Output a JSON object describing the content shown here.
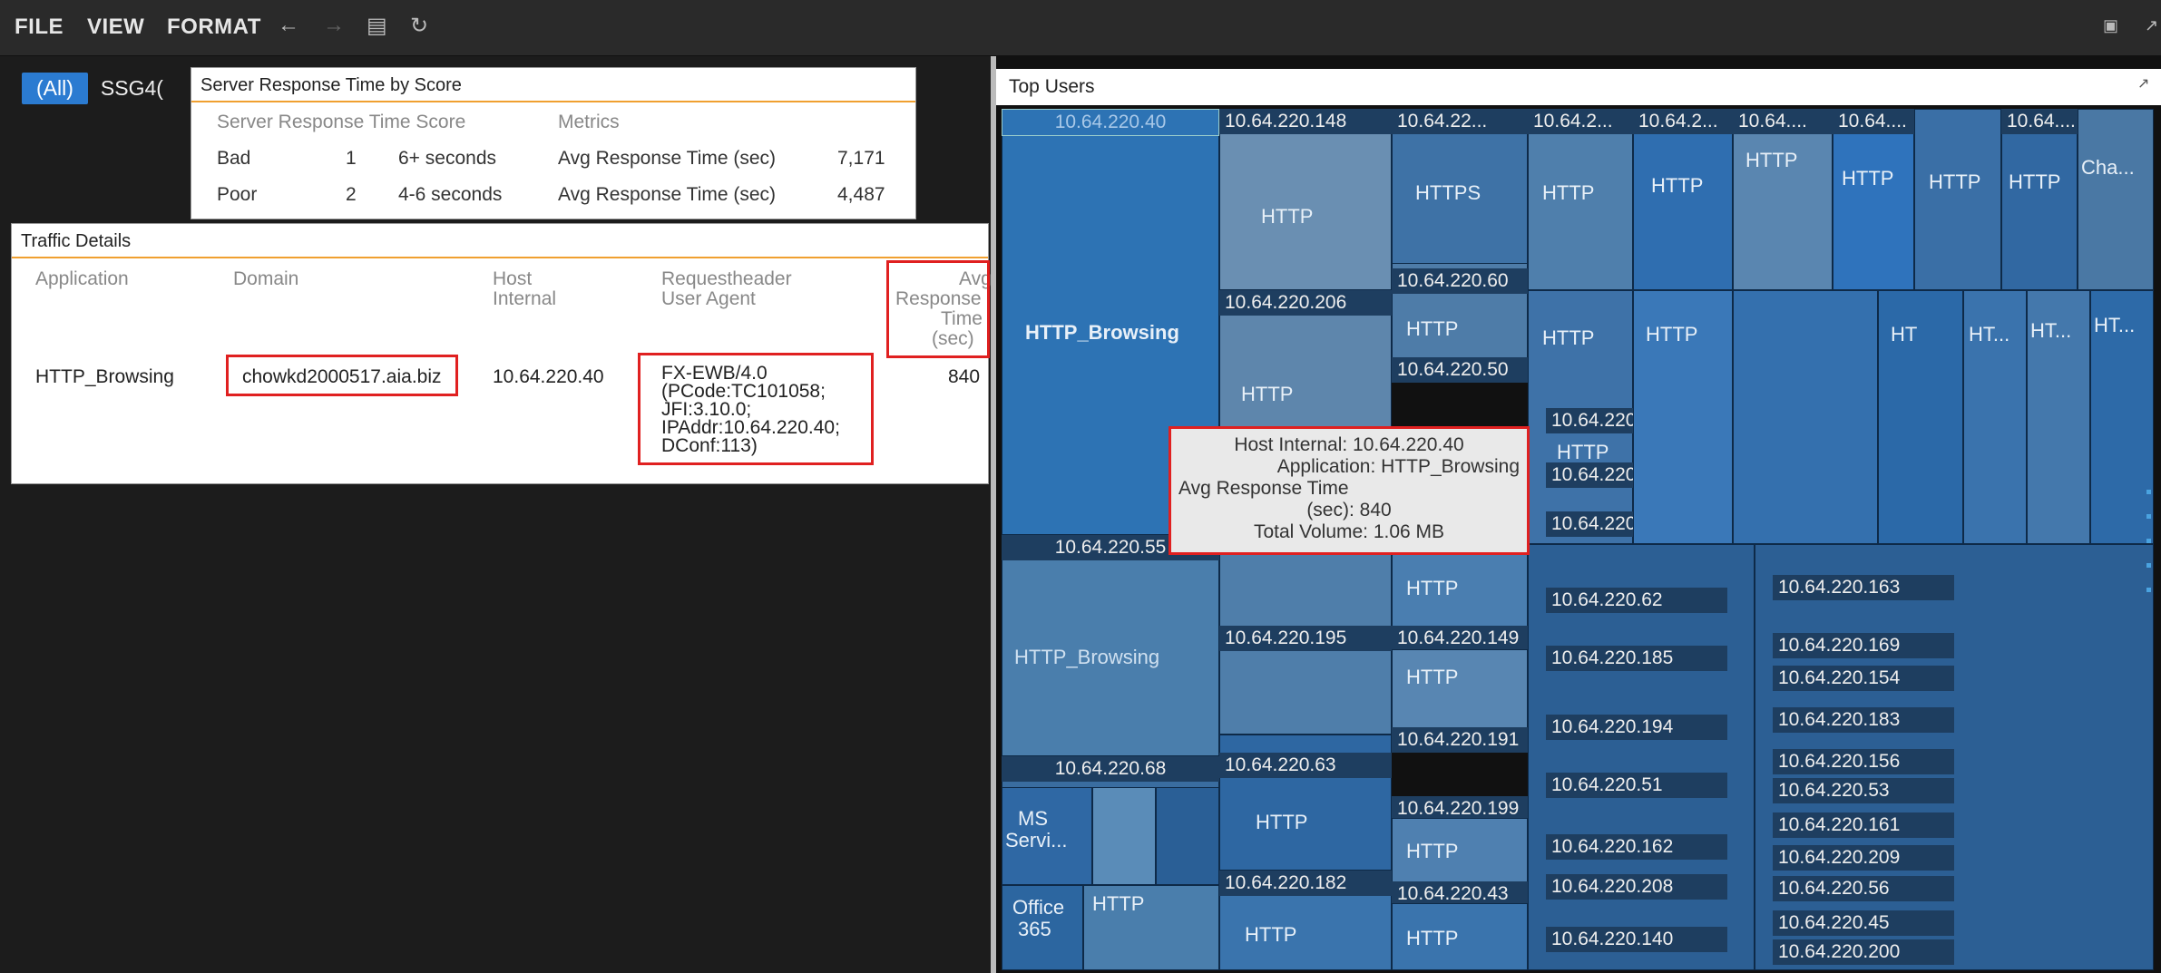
{
  "menu": {
    "file": "FILE",
    "view": "VIEW",
    "format": "FORMAT",
    "undo_icon": "undo-icon",
    "redo_icon": "redo-icon",
    "save_icon": "save-icon",
    "refresh_icon": "refresh-icon"
  },
  "filter": {
    "all": "(All)",
    "ssg": "SSG4("
  },
  "srt": {
    "title": "Server Response Time by Score",
    "headers": [
      "Server Response Time Score",
      "Metrics"
    ],
    "rows": [
      {
        "label": "Bad",
        "score": "1",
        "range": "6+ seconds",
        "metric": "Avg Response Time (sec)",
        "value": "7,171"
      },
      {
        "label": "Poor",
        "score": "2",
        "range": "4-6 seconds",
        "metric": "Avg Response Time (sec)",
        "value": "4,487"
      }
    ]
  },
  "traffic": {
    "title": "Traffic Details",
    "headers": {
      "application": "Application",
      "domain": "Domain",
      "host1": "Host",
      "host2": "Internal",
      "req1": "Requestheader",
      "req2": "User Agent",
      "avg1": "Avg",
      "avg2": "Response",
      "avg3": "Time",
      "avg4": "(sec)"
    },
    "row": {
      "application": "HTTP_Browsing",
      "domain": "chowkd2000517.aia.biz",
      "host": "10.64.220.40",
      "ua1": "FX-EWB/4.0",
      "ua2": "(PCode:TC101058;",
      "ua3": "JFI:3.10.0;",
      "ua4": "IPAddr:10.64.220.40;",
      "ua5": "DConf:113)",
      "avg": "840"
    }
  },
  "topusers": {
    "title": "Top Users",
    "labels": {
      "h40": "10.64.220.40",
      "h148": "10.64.220.148",
      "h22": "10.64.22...",
      "h2a": "10.64.2...",
      "h2b": "10.64.2...",
      "h64a": "10.64....",
      "h64b": "10.64....",
      "h64c": "10.64....",
      "h206": "10.64.220.206",
      "h60": "10.64.220.60",
      "h50": "10.64.220.50",
      "h168": "10.64.220.168",
      "h167": "10.64.220.167",
      "h55": "10.64.220.55",
      "h90": "10.64.220.90",
      "h62": "10.64.220.62",
      "h163": "10.64.220.163",
      "h195": "10.64.220.195",
      "h149": "10.64.220.149",
      "h169": "10.64.220.169",
      "h185": "10.64.220.185",
      "h154": "10.64.220.154",
      "h191": "10.64.220.191",
      "h194": "10.64.220.194",
      "h183": "10.64.220.183",
      "h156": "10.64.220.156",
      "h68": "10.64.220.68",
      "h63": "10.64.220.63",
      "h51": "10.64.220.51",
      "h53": "10.64.220.53",
      "h199": "10.64.220.199",
      "h162": "10.64.220.162",
      "h161": "10.64.220.161",
      "h209": "10.64.220.209",
      "h182": "10.64.220.182",
      "h208": "10.64.220.208",
      "h43": "10.64.220.43",
      "h56": "10.64.220.56",
      "h45": "10.64.220.45",
      "h140": "10.64.220.140",
      "h200": "10.64.220.200"
    },
    "apps": {
      "http": "HTTP",
      "https": "HTTPS",
      "browsing": "HTTP_Browsing",
      "cha": "Cha...",
      "ht": "HT...",
      "ht2": "HT",
      "ms1": "MS",
      "ms2": "Servi...",
      "office1": "Office",
      "office2": "365"
    }
  },
  "tooltip": {
    "l1": "Host Internal: 10.64.220.40",
    "l2": "Application: HTTP_Browsing",
    "l3": "Avg Response Time",
    "l4": "(sec): 840",
    "l5": "Total Volume: 1.06 MB"
  }
}
